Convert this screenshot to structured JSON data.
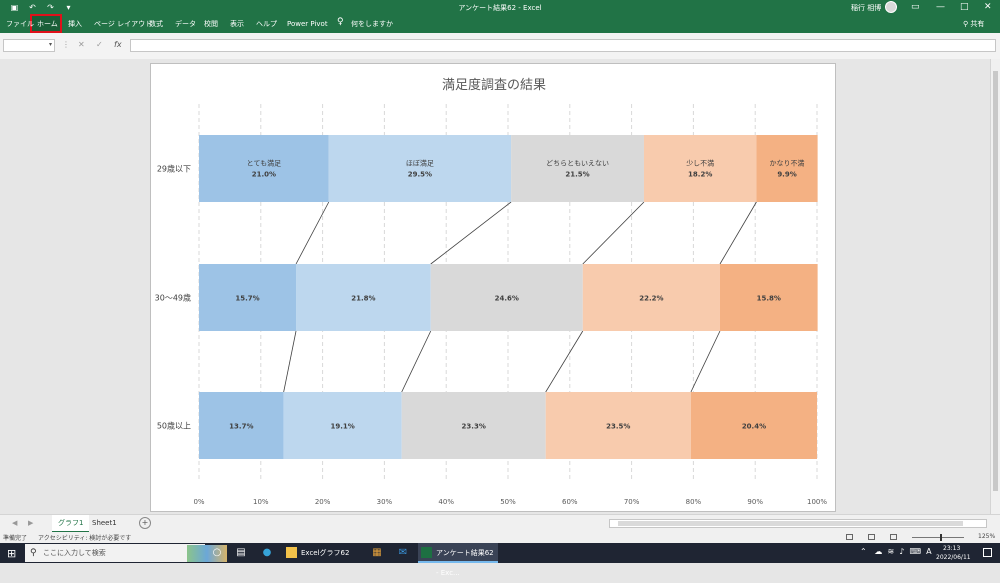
{
  "window": {
    "title": "アンケート結果62 - Excel",
    "user": "稲行 相博",
    "qat": {
      "save_icon": "save-icon",
      "undo_icon": "undo-icon",
      "redo_icon": "redo-icon"
    },
    "controls": [
      "▭",
      "—",
      "□",
      "✕"
    ]
  },
  "ribbon": {
    "tabs": [
      "ファイル",
      "ホーム",
      "挿入",
      "ページ レイアウト",
      "数式",
      "データ",
      "校閲",
      "表示",
      "ヘルプ",
      "Power Pivot"
    ],
    "tell_me": "何をしますか",
    "share": "共有",
    "highlighted_tab": "ホーム"
  },
  "formula_bar": {
    "name_box": "",
    "cancel": "✕",
    "enter": "✓",
    "fx": "fx",
    "value": ""
  },
  "chart_data": {
    "type": "bar",
    "orientation": "horizontal-stacked-100",
    "title": "満足度調査の結果",
    "categories": [
      "29歳以下",
      "30〜49歳",
      "50歳以上"
    ],
    "series": [
      {
        "name": "とても満足",
        "color": "#9dc3e6",
        "values": [
          21.0,
          15.7,
          13.7
        ]
      },
      {
        "name": "ほぼ満足",
        "color": "#bdd7ee",
        "values": [
          29.5,
          21.8,
          19.1
        ]
      },
      {
        "name": "どちらともいえない",
        "color": "#d9d9d9",
        "values": [
          21.5,
          24.6,
          23.3
        ]
      },
      {
        "name": "少し不満",
        "color": "#f8cbad",
        "values": [
          18.2,
          22.2,
          23.5
        ]
      },
      {
        "name": "かなり不満",
        "color": "#f4b183",
        "values": [
          9.9,
          15.8,
          20.4
        ]
      }
    ],
    "value_labels": [
      [
        "21.0%",
        "29.5%",
        "21.5%",
        "18.2%",
        "9.9%"
      ],
      [
        "15.7%",
        "21.8%",
        "24.6%",
        "22.2%",
        "15.8%"
      ],
      [
        "13.7%",
        "19.1%",
        "23.3%",
        "23.5%",
        "20.4%"
      ]
    ],
    "series_names_shown_on_first_bar": true,
    "xlim": [
      0,
      100
    ],
    "xticks": [
      "0%",
      "10%",
      "20%",
      "30%",
      "40%",
      "50%",
      "60%",
      "70%",
      "80%",
      "90%",
      "100%"
    ],
    "gridlines": "dashed-vertical",
    "series_lines": true,
    "legend": "none"
  },
  "sheets": {
    "tabs": [
      "グラフ1",
      "Sheet1"
    ],
    "active": "グラフ1"
  },
  "status": {
    "ready": "準備完了",
    "accessibility": "アクセシビリティ: 検討が必要です",
    "zoom": "125%"
  },
  "taskbar": {
    "search_placeholder": "ここに入力して検索",
    "apps": [
      "Excelグラフ62",
      "アンケート結果62 - Exc..."
    ],
    "ime": "A",
    "time": "23:13",
    "date": "2022/06/11"
  }
}
